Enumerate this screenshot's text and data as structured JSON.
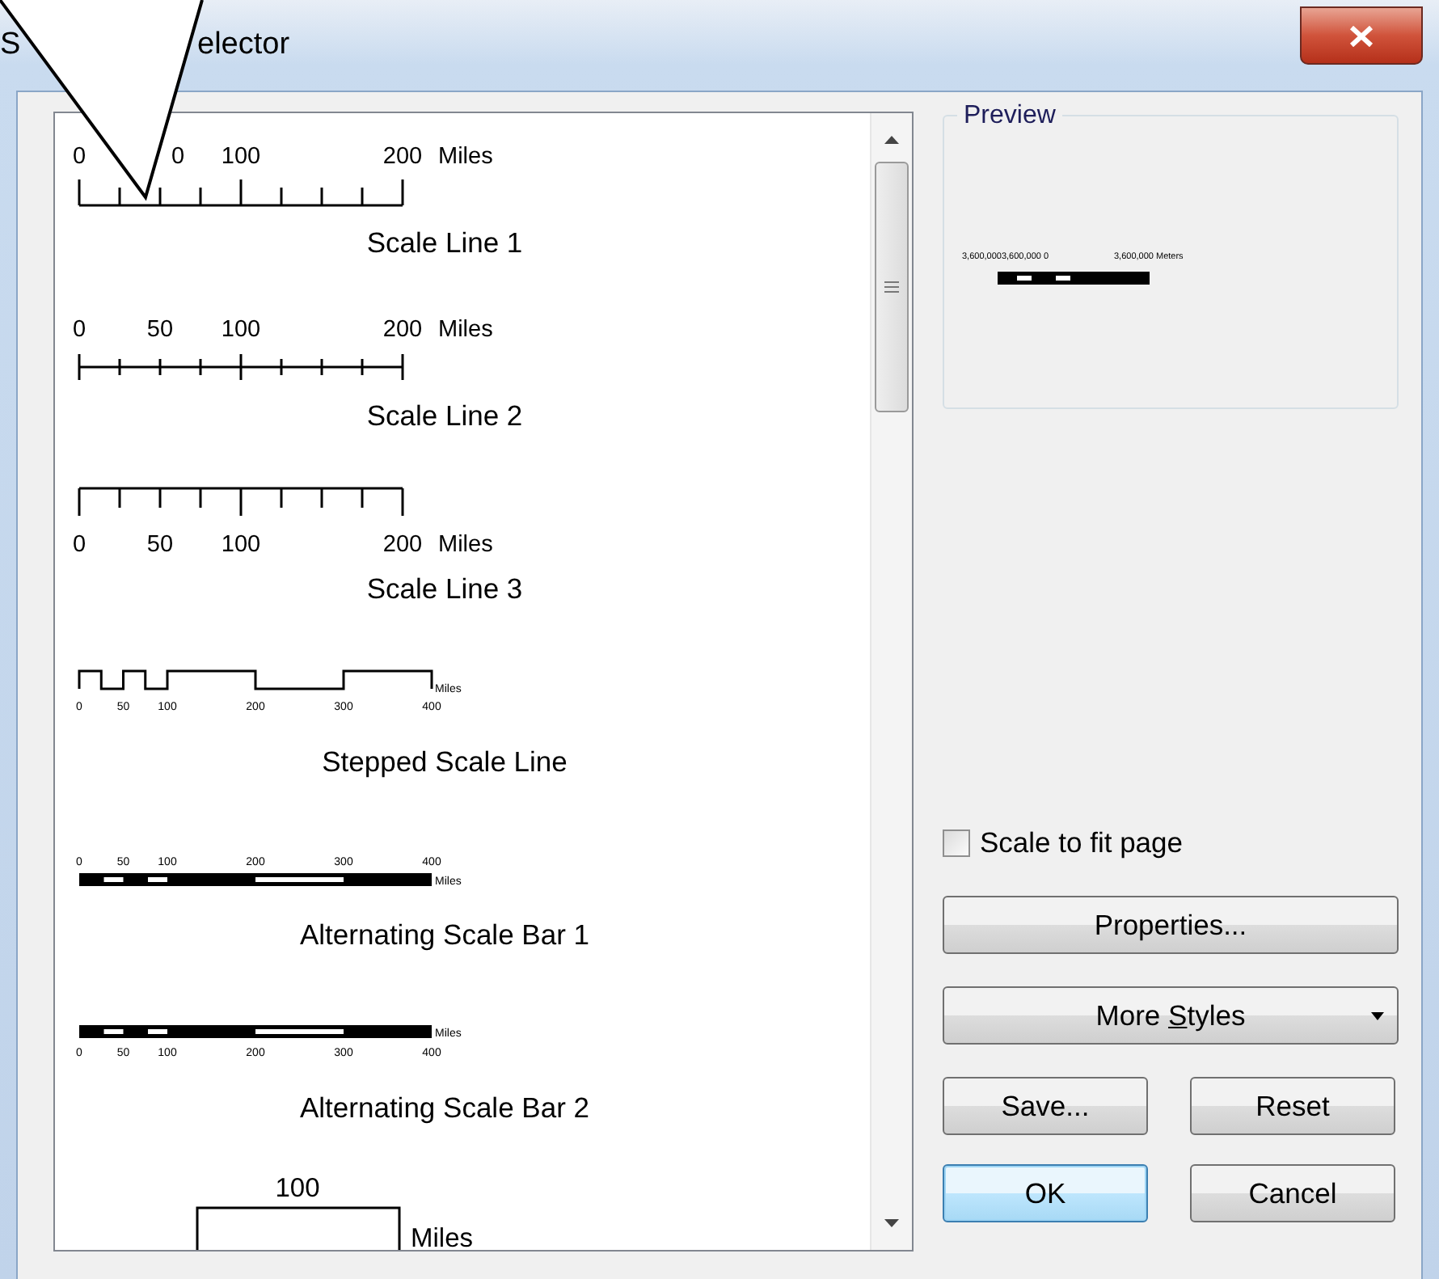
{
  "window": {
    "title_fragments": [
      "S",
      "elector"
    ]
  },
  "styles": [
    {
      "kind": "ticks_up",
      "labels": [
        "0",
        "0",
        "100",
        "200"
      ],
      "unit": "Miles",
      "title": "Scale Line 1"
    },
    {
      "kind": "ticks_cross",
      "labels": [
        "0",
        "50",
        "100",
        "200"
      ],
      "unit": "Miles",
      "title": "Scale Line 2"
    },
    {
      "kind": "ticks_down",
      "labels": [
        "0",
        "50",
        "100",
        "200"
      ],
      "unit": "Miles",
      "title": "Scale Line 3"
    },
    {
      "kind": "stepped",
      "labels": [
        "0",
        "50",
        "100",
        "200",
        "300",
        "400"
      ],
      "unit": "Miles",
      "title": "Stepped Scale Line"
    },
    {
      "kind": "bar_above",
      "labels": [
        "0",
        "50",
        "100",
        "200",
        "300",
        "400"
      ],
      "unit": "Miles",
      "title": "Alternating Scale Bar 1"
    },
    {
      "kind": "bar_below",
      "labels": [
        "0",
        "50",
        "100",
        "200",
        "300",
        "400"
      ],
      "unit": "Miles",
      "title": "Alternating Scale Bar 2"
    },
    {
      "kind": "hollow",
      "labels": [
        "100"
      ],
      "unit": "Miles"
    }
  ],
  "preview": {
    "legend": "Preview",
    "labels": [
      "3,600,0003,600,000 0",
      "3,600,000 Meters"
    ]
  },
  "scale_to_fit": {
    "label": "Scale to fit page",
    "checked": false
  },
  "buttons": {
    "properties": "Properties...",
    "more_styles": {
      "before_key": "More ",
      "access_key": "S",
      "after_key": "tyles"
    },
    "save": "Save...",
    "reset": "Reset",
    "ok": "OK",
    "cancel": "Cancel"
  }
}
